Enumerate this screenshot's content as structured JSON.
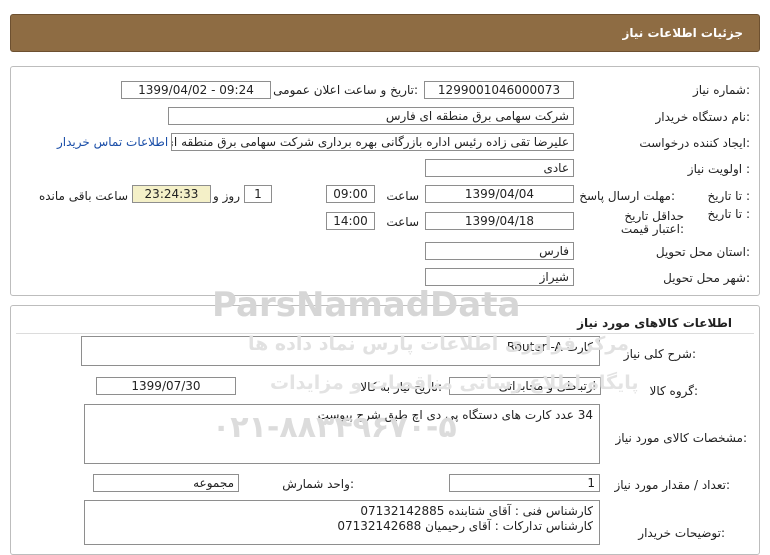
{
  "header": {
    "title": "جزئیات اطلاعات نیاز"
  },
  "need": {
    "number_label": "شماره نیاز:",
    "number_value": "1299001046000073",
    "announce_label": "تاریخ و ساعت اعلان عمومی:",
    "announce_value": "1399/04/02 - 09:24",
    "buyer_label": "نام دستگاه خریدار:",
    "buyer_value": "شرکت سهامی برق منطقه ای فارس",
    "creator_label": "ایجاد کننده درخواست:",
    "creator_value": "علیرضا  تقی زاده رئیس اداره بازرگانی بهره برداری شرکت سهامی برق منطقه ای",
    "contact_link": "اطلاعات تماس خریدار",
    "priority_label": "اولویت نیاز :",
    "priority_value": "عادی",
    "send_deadline_label": "مهلت ارسال پاسخ:",
    "to_date_label": "تا تاریخ :",
    "send_date": "1399/04/04",
    "time_label": "ساعت",
    "send_time": "09:00",
    "days_value": "1",
    "days_label": "روز و",
    "remaining_value": "23:24:33",
    "remaining_label": "ساعت باقی مانده",
    "validity_label": "حداقل تاریخ اعتبار قیمت:",
    "validity_to_label": "تا تاریخ :",
    "validity_date": "1399/04/18",
    "validity_time_label": "ساعت",
    "validity_time": "14:00",
    "province_label": "استان محل تحویل:",
    "province_value": "فارس",
    "city_label": "شهر محل تحویل:",
    "city_value": "شیراز"
  },
  "goods": {
    "section_title": "اطلاعات کالاهای مورد نیاز",
    "desc_label": "شرح کلی نیاز:",
    "desc_value": "کارت Router -A",
    "group_label": "گروه کالا:",
    "group_value": "ارتباطی و مخابراتی",
    "need_date_label": "تاریخ نیاز به کالا:",
    "need_date_value": "1399/07/30",
    "spec_label": "مشخصات کالای مورد نیاز:",
    "spec_value": "34 عدد کارت های دستگاه پی دی اچ طبق شرح پیوست",
    "qty_label": "تعداد / مقدار مورد نیاز:",
    "qty_value": "1",
    "unit_label": "واحد شمارش:",
    "unit_value": "مجموعه",
    "notes_label": "توضیحات خریدار:",
    "notes_line1": "کارشناس فنی : آقای شتابنده 07132142885",
    "notes_line2": "کارشناس تدارکات : آقای رحیمیان 07132142688"
  },
  "watermark": {
    "line1": "ParsNamadData",
    "line2": "مرکز فراوری اطلاعات پارس نماد داده ها",
    "line3": "پایگاه اطلاع رسانی مناقصات و مزایدات",
    "line4": "۰۲۱-۸۸۳۴۹۶۷۰-۵"
  }
}
